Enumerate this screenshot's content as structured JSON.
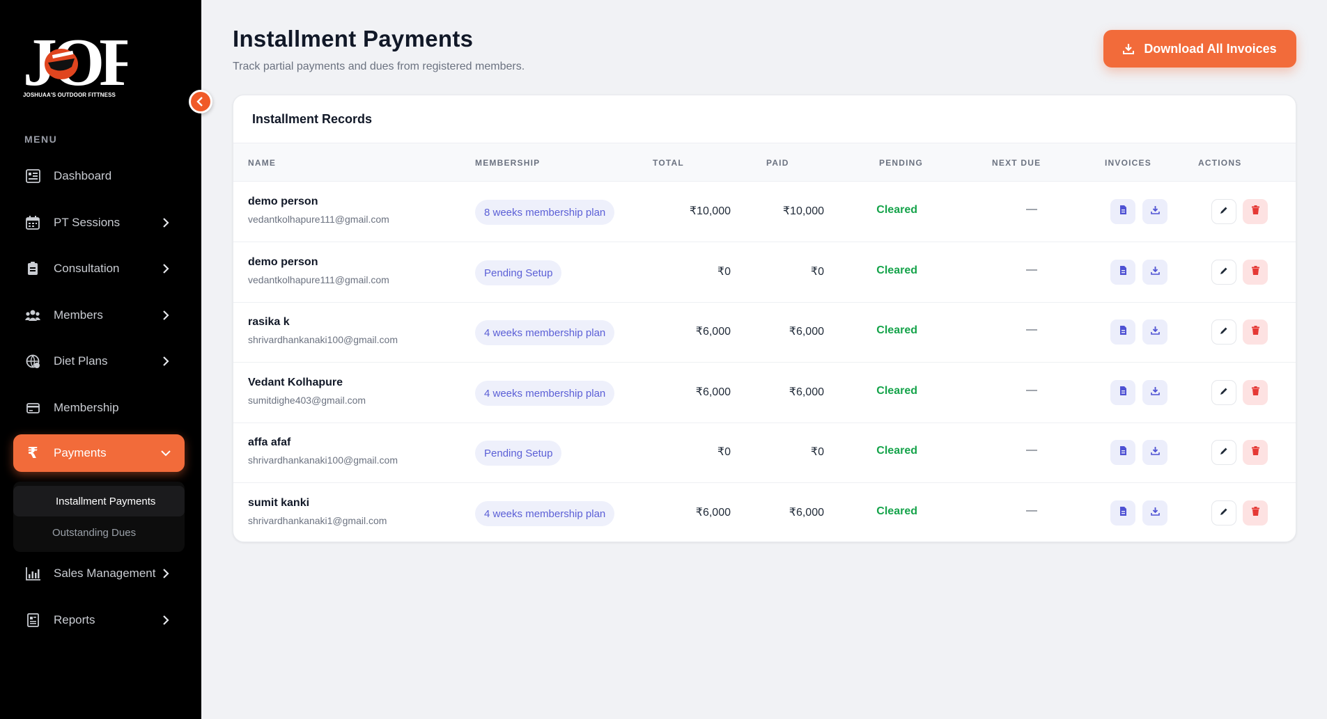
{
  "brand": {
    "logo_text": "JOF",
    "caption": "JOSHUAA'S OUTDOOR FITTNESS",
    "accent": "#f26b3a"
  },
  "sidebar": {
    "menu_label": "MENU",
    "items": [
      {
        "label": "Dashboard",
        "icon": "dashboard-icon",
        "has_chevron": false
      },
      {
        "label": "PT Sessions",
        "icon": "calendar-icon",
        "has_chevron": true
      },
      {
        "label": "Consultation",
        "icon": "clipboard-icon",
        "has_chevron": true
      },
      {
        "label": "Members",
        "icon": "users-icon",
        "has_chevron": true
      },
      {
        "label": "Diet Plans",
        "icon": "globe-food-icon",
        "has_chevron": true
      },
      {
        "label": "Membership",
        "icon": "card-icon",
        "has_chevron": false
      },
      {
        "label": "Payments",
        "icon": "rupee-icon",
        "has_chevron": true,
        "active": true
      },
      {
        "label": "Sales Management",
        "icon": "bar-chart-icon",
        "has_chevron": true
      },
      {
        "label": "Reports",
        "icon": "report-icon",
        "has_chevron": true
      }
    ],
    "payments_submenu": [
      {
        "label": "Installment Payments",
        "active": true
      },
      {
        "label": "Outstanding Dues",
        "active": false
      }
    ]
  },
  "header": {
    "title": "Installment Payments",
    "subtitle": "Track partial payments and dues from registered members.",
    "download_all_label": "Download All Invoices"
  },
  "card": {
    "title": "Installment Records",
    "columns": [
      "NAME",
      "MEMBERSHIP",
      "TOTAL",
      "PAID",
      "PENDING",
      "NEXT DUE",
      "INVOICES",
      "ACTIONS"
    ],
    "rows": [
      {
        "name": "demo person",
        "email": "vedantkolhapure111@gmail.com",
        "membership": "8 weeks membership plan",
        "total": "₹10,000",
        "paid": "₹10,000",
        "pending": "Cleared",
        "next_due": "—"
      },
      {
        "name": "demo person",
        "email": "vedantkolhapure111@gmail.com",
        "membership": "Pending Setup",
        "total": "₹0",
        "paid": "₹0",
        "pending": "Cleared",
        "next_due": "—"
      },
      {
        "name": "rasika k",
        "email": "shrivardhankanaki100@gmail.com",
        "membership": "4 weeks membership plan",
        "total": "₹6,000",
        "paid": "₹6,000",
        "pending": "Cleared",
        "next_due": "—"
      },
      {
        "name": "Vedant Kolhapure",
        "email": "sumitdighe403@gmail.com",
        "membership": "4 weeks membership plan",
        "total": "₹6,000",
        "paid": "₹6,000",
        "pending": "Cleared",
        "next_due": "—"
      },
      {
        "name": "affa afaf",
        "email": "shrivardhankanaki100@gmail.com",
        "membership": "Pending Setup",
        "total": "₹0",
        "paid": "₹0",
        "pending": "Cleared",
        "next_due": "—"
      },
      {
        "name": "sumit kanki",
        "email": "shrivardhankanaki1@gmail.com",
        "membership": "4 weeks membership plan",
        "total": "₹6,000",
        "paid": "₹6,000",
        "pending": "Cleared",
        "next_due": "—"
      }
    ]
  }
}
